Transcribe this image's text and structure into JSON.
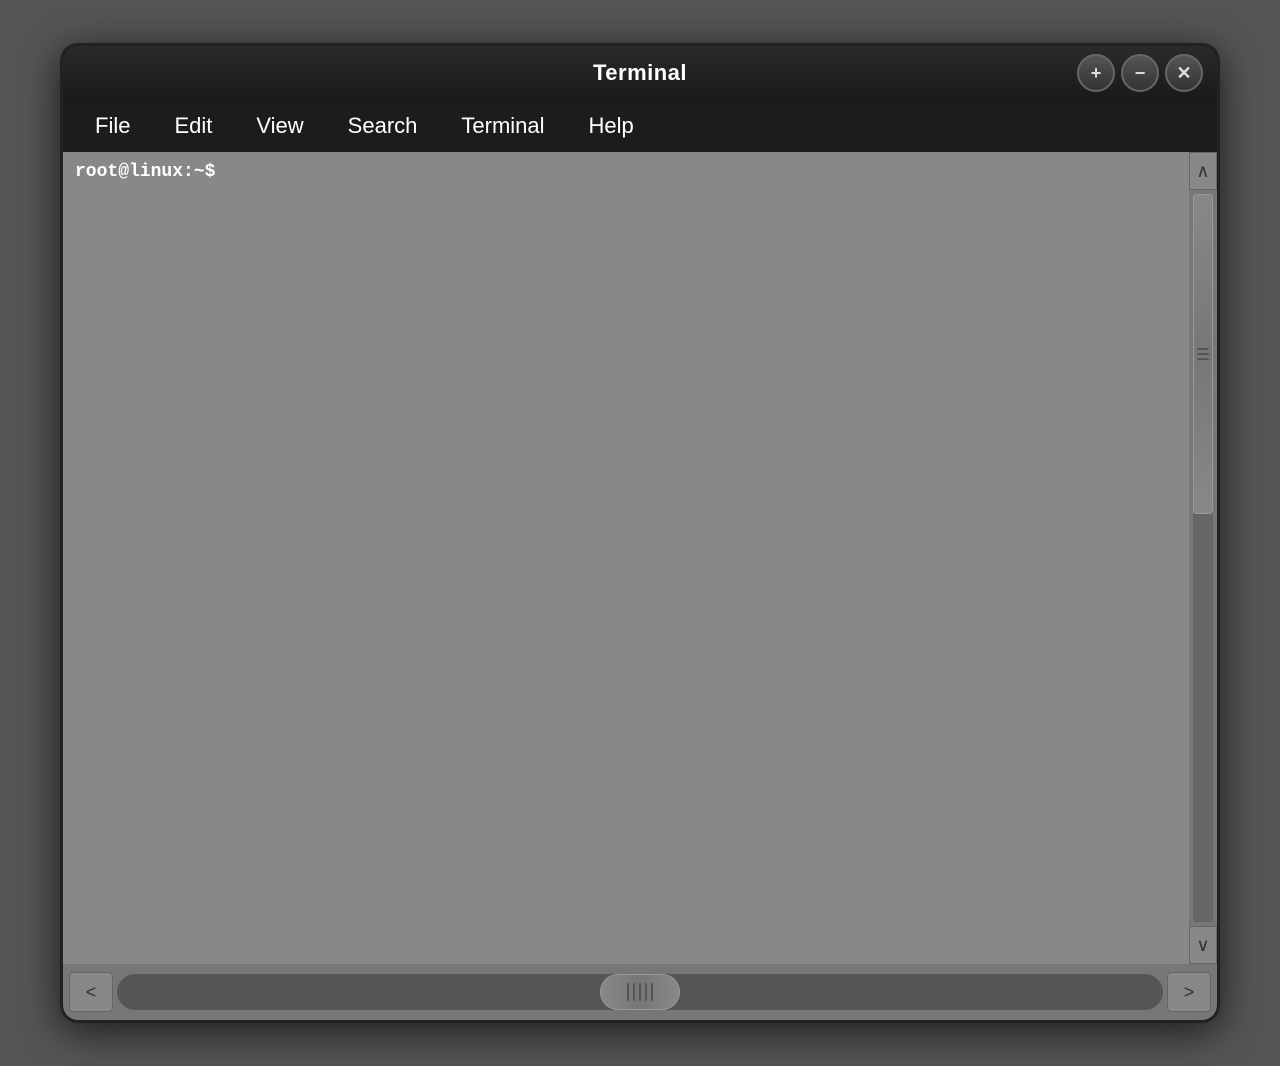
{
  "titlebar": {
    "title": "Terminal",
    "controls": {
      "add_label": "+",
      "minimize_label": "−",
      "close_label": "✕"
    }
  },
  "menubar": {
    "items": [
      {
        "id": "file",
        "label": "File"
      },
      {
        "id": "edit",
        "label": "Edit"
      },
      {
        "id": "view",
        "label": "View"
      },
      {
        "id": "search",
        "label": "Search"
      },
      {
        "id": "terminal",
        "label": "Terminal"
      },
      {
        "id": "help",
        "label": "Help"
      }
    ]
  },
  "terminal": {
    "prompt": "root@linux:~$"
  },
  "scrollbar": {
    "up_arrow": "∧",
    "down_arrow": "∨",
    "left_arrow": "<",
    "right_arrow": ">"
  }
}
